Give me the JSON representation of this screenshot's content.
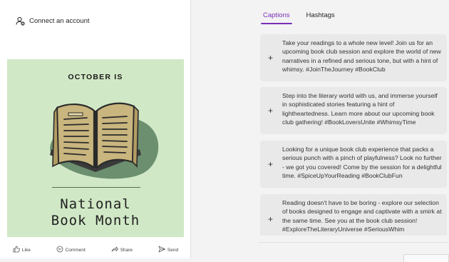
{
  "account": {
    "connect_label": "Connect an account"
  },
  "post": {
    "kicker": "OCTOBER IS",
    "headline_line1": "National",
    "headline_line2": "Book Month",
    "image_bg": "#d1e8c6",
    "actions": {
      "like": "Like",
      "comment": "Comment",
      "share": "Share",
      "send": "Send"
    }
  },
  "tabs": [
    {
      "label": "Captions",
      "active": true
    },
    {
      "label": "Hashtags",
      "active": false
    }
  ],
  "captions": [
    {
      "plus": "+",
      "text": "Take your readings to a whole new level! Join us for an upcoming book club session and explore the world of new narratives in a refined and serious tone, but with a hint of whimsy. #JoinTheJourney #BookClub"
    },
    {
      "plus": "+",
      "text": "Step into the literary world with us, and immerse yourself in sophisticated stories featuring a hint of lightheartedness. Learn more about our upcoming book club gathering! #BookLoversUnite #WhimsyTime"
    },
    {
      "plus": "+",
      "text": "Looking for a unique book club experience that packs a serious punch with a pinch of playfulness? Look no further - we got you covered! Come by the session for a delightful time. #SpiceUpYourReading #BookClubFun"
    },
    {
      "plus": "+",
      "text": "Reading doesn't have to be boring - explore our selection of books designed to engage and captivate with a smirk at the same time. See you at the book club session! #ExploreTheLiteraryUniverse #SeriousWhim"
    }
  ],
  "colors": {
    "accent": "#7a2fb5",
    "card_bg": "#e9e9e9",
    "panel_bg": "#f3f3f3"
  }
}
